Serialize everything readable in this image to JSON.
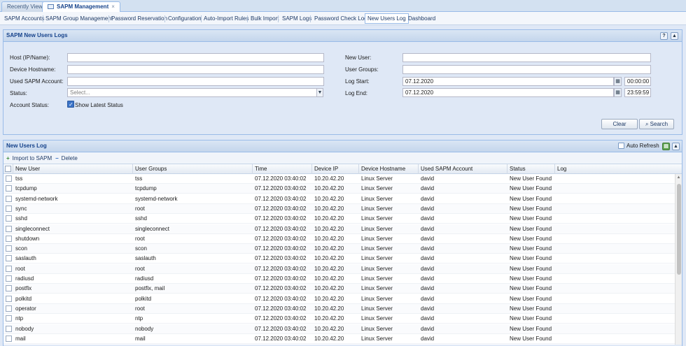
{
  "top_tabs": [
    {
      "label": "Recently View",
      "active": false
    },
    {
      "label": "SAPM Management",
      "active": true,
      "close": "×"
    }
  ],
  "subnav": [
    {
      "label": "SAPM Accounts",
      "active": false
    },
    {
      "label": "SAPM Group Management",
      "active": false
    },
    {
      "label": "Password Reservation",
      "active": false
    },
    {
      "label": "Configuration",
      "active": false
    },
    {
      "label": "Auto-Import Rules",
      "active": false
    },
    {
      "label": "Bulk Import",
      "active": false
    },
    {
      "label": "SAPM Logs",
      "active": false
    },
    {
      "label": "Password Check Log",
      "active": false
    },
    {
      "label": "New Users Log",
      "active": true
    },
    {
      "label": "Dashboard",
      "active": false
    }
  ],
  "filter_panel": {
    "title": "SAPM New Users Logs",
    "host_label": "Host (IP/Name):",
    "host_value": "",
    "device_hostname_label": "Device Hostname:",
    "device_hostname_value": "",
    "used_account_label": "Used SAPM Account:",
    "used_account_value": "",
    "status_label": "Status:",
    "status_placeholder": "Select...",
    "account_status_label": "Account Status:",
    "show_latest_label": "Show Latest Status",
    "show_latest_checked": true,
    "new_user_label": "New User:",
    "new_user_value": "",
    "user_groups_label": "User Groups:",
    "user_groups_value": "",
    "log_start_label": "Log Start:",
    "log_start_date": "07.12.2020",
    "log_start_time": "00:00:00",
    "log_end_label": "Log End:",
    "log_end_date": "07.12.2020",
    "log_end_time": "23:59:59",
    "clear_label": "Clear",
    "search_label": "Search"
  },
  "grid_panel": {
    "title": "New Users Log",
    "auto_refresh_label": "Auto Refresh",
    "auto_refresh_checked": false,
    "import_label": "Import to SAPM",
    "delete_label": "Delete",
    "columns": [
      "New User",
      "User Groups",
      "Time",
      "Device IP",
      "Device Hostname",
      "Used SAPM Account",
      "Status",
      "Log"
    ],
    "rows": [
      [
        "tss",
        "tss",
        "07.12.2020 03:40:02",
        "10.20.42.20",
        "Linux Server",
        "david",
        "New User Found",
        ""
      ],
      [
        "tcpdump",
        "tcpdump",
        "07.12.2020 03:40:02",
        "10.20.42.20",
        "Linux Server",
        "david",
        "New User Found",
        ""
      ],
      [
        "systemd-network",
        "systemd-network",
        "07.12.2020 03:40:02",
        "10.20.42.20",
        "Linux Server",
        "david",
        "New User Found",
        ""
      ],
      [
        "sync",
        "root",
        "07.12.2020 03:40:02",
        "10.20.42.20",
        "Linux Server",
        "david",
        "New User Found",
        ""
      ],
      [
        "sshd",
        "sshd",
        "07.12.2020 03:40:02",
        "10.20.42.20",
        "Linux Server",
        "david",
        "New User Found",
        ""
      ],
      [
        "singleconnect",
        "singleconnect",
        "07.12.2020 03:40:02",
        "10.20.42.20",
        "Linux Server",
        "david",
        "New User Found",
        ""
      ],
      [
        "shutdown",
        "root",
        "07.12.2020 03:40:02",
        "10.20.42.20",
        "Linux Server",
        "david",
        "New User Found",
        ""
      ],
      [
        "scon",
        "scon",
        "07.12.2020 03:40:02",
        "10.20.42.20",
        "Linux Server",
        "david",
        "New User Found",
        ""
      ],
      [
        "saslauth",
        "saslauth",
        "07.12.2020 03:40:02",
        "10.20.42.20",
        "Linux Server",
        "david",
        "New User Found",
        ""
      ],
      [
        "root",
        "root",
        "07.12.2020 03:40:02",
        "10.20.42.20",
        "Linux Server",
        "david",
        "New User Found",
        ""
      ],
      [
        "radiusd",
        "radiusd",
        "07.12.2020 03:40:02",
        "10.20.42.20",
        "Linux Server",
        "david",
        "New User Found",
        ""
      ],
      [
        "postfix",
        "postfix, mail",
        "07.12.2020 03:40:02",
        "10.20.42.20",
        "Linux Server",
        "david",
        "New User Found",
        ""
      ],
      [
        "polkitd",
        "polkitd",
        "07.12.2020 03:40:02",
        "10.20.42.20",
        "Linux Server",
        "david",
        "New User Found",
        ""
      ],
      [
        "operator",
        "root",
        "07.12.2020 03:40:02",
        "10.20.42.20",
        "Linux Server",
        "david",
        "New User Found",
        ""
      ],
      [
        "ntp",
        "ntp",
        "07.12.2020 03:40:02",
        "10.20.42.20",
        "Linux Server",
        "david",
        "New User Found",
        ""
      ],
      [
        "nobody",
        "nobody",
        "07.12.2020 03:40:02",
        "10.20.42.20",
        "Linux Server",
        "david",
        "New User Found",
        ""
      ],
      [
        "mail",
        "mail",
        "07.12.2020 03:40:02",
        "10.20.42.20",
        "Linux Server",
        "david",
        "New User Found",
        ""
      ]
    ]
  }
}
